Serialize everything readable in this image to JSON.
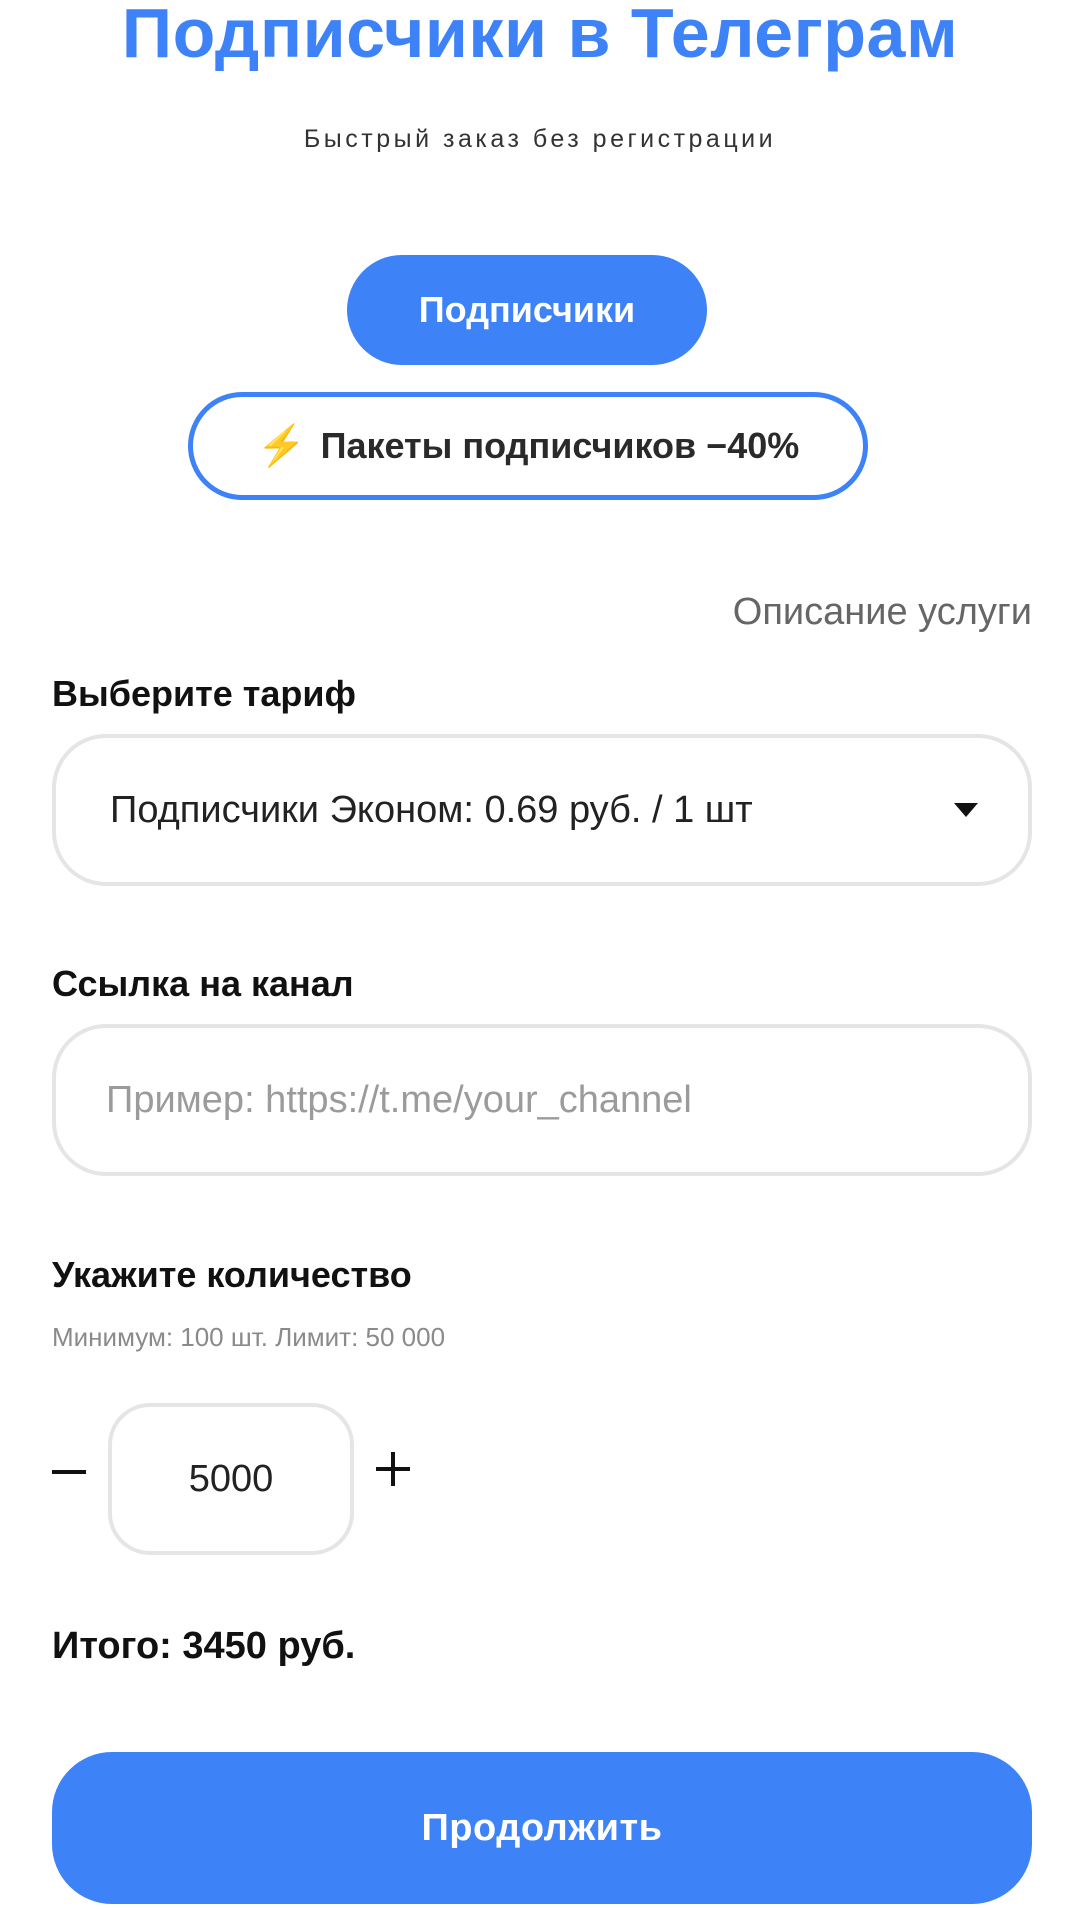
{
  "header": {
    "title": "Подписчики в Телеграм",
    "subtitle": "Быстрый заказ без регистрации"
  },
  "tabs": {
    "primary_label": "Подписчики",
    "packages_label": "Пакеты подписчиков −40%",
    "packages_icon": "lightning-icon"
  },
  "service_description_link": "Описание услуги",
  "tariff": {
    "label": "Выберите тариф",
    "selected_value": "Подписчики Эконом: 0.69 руб. / 1 шт",
    "dropdown_icon": "chevron-down-icon"
  },
  "channel_link": {
    "label": "Ссылка на канал",
    "value": "",
    "placeholder": "Пример: https://t.me/your_channel"
  },
  "quantity": {
    "label": "Укажите количество",
    "hint": "Минимум: 100 шт. Лимит: 50 000",
    "value": "5000",
    "minus_icon": "minus-icon",
    "plus_icon": "plus-icon"
  },
  "total": "Итого: 3450 руб.",
  "continue_label": "Продолжить",
  "colors": {
    "accent": "#3d82f6",
    "bolt": "#f6b01b",
    "border": "#e5e5e5"
  }
}
